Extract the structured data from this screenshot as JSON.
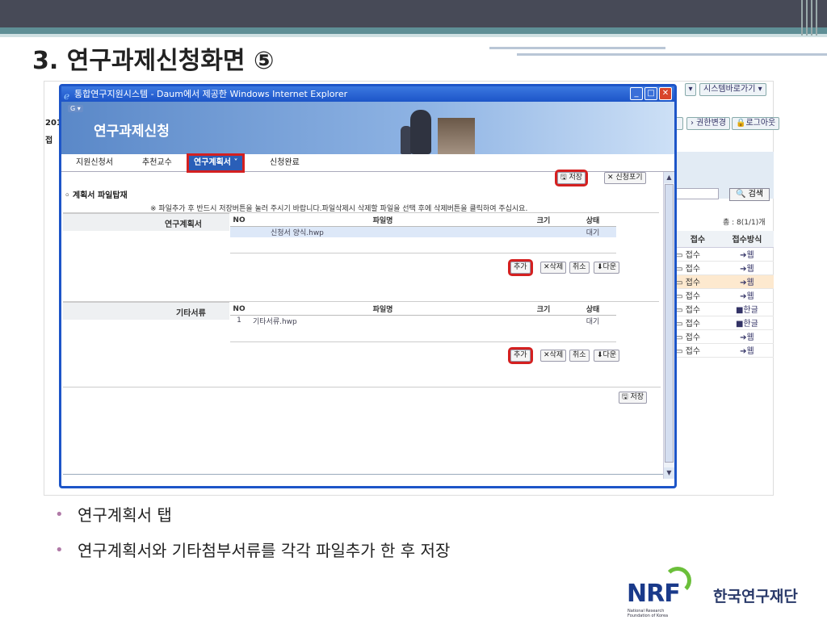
{
  "slide": {
    "title": "3. 연구과제신청화면 ⑤",
    "bullets": [
      "연구계획서 탭",
      "연구계획서와 기타첨부서류를 각각 파일추가 한 후 저장"
    ]
  },
  "background_app": {
    "topright_button": "시스템바로가기 ▾",
    "topright_arrow": "▾",
    "nav_change_permission": "› 권한변경",
    "nav_logout": "🔒로그아웃",
    "year_label": "201",
    "year_label2": "접",
    "search_button": "🔍 검색",
    "count_text": "총 : 8(1/1)개",
    "table_headers": [
      "접수",
      "접수방식"
    ],
    "rows": [
      {
        "status": "▭ 접수",
        "method": "➔웹"
      },
      {
        "status": "▭ 접수",
        "method": "➔웹"
      },
      {
        "status": "▭ 접수",
        "method": "➔웹"
      },
      {
        "status": "▭ 접수",
        "method": "➔웹"
      },
      {
        "status": "▭ 접수",
        "method": "■한글"
      },
      {
        "status": "▭ 접수",
        "method": "■한글"
      },
      {
        "status": "▭ 접수",
        "method": "➔웹"
      },
      {
        "status": "▭ 접수",
        "method": "➔웹"
      }
    ]
  },
  "popup": {
    "window_title": "통합연구지원시스템 - Daum에서 제공한 Windows Internet Explorer",
    "banner_title": "연구과제신청",
    "tabs": [
      "지원신청서",
      "추천교수",
      "연구계획서 ˅",
      "신청완료"
    ],
    "save_button": "🖫 저장",
    "cancel_apply_button": "✕ 신청포기",
    "section_title": "◦ 계획서 파일탑재",
    "notice": "※ 파일추가 후 반드시 저장버튼을 눌러 주시기 바랍니다.파일삭제시 삭제할 파일을 선택 후에 삭제버튼을 클릭하여 주십시요.",
    "plan_label": "연구계획서",
    "other_label": "기타서류",
    "file_headers": [
      "NO",
      "파일명",
      "크기",
      "상태"
    ],
    "plan_files": [
      {
        "no": "",
        "name": "신청서 양식.hwp",
        "size": "",
        "status": "대기"
      }
    ],
    "other_files": [
      {
        "no": "1",
        "name": "기타서류.hwp",
        "size": "",
        "status": "대기"
      }
    ],
    "add_button": "추가",
    "delete_button": "✕삭제",
    "cancel_button": "취소",
    "download_button": "⬇다운",
    "bottom_save": "🖫 저장"
  },
  "logo": {
    "letters": "NRF",
    "sub": "National Research Foundation of Korea",
    "korean": "한국연구재단"
  }
}
